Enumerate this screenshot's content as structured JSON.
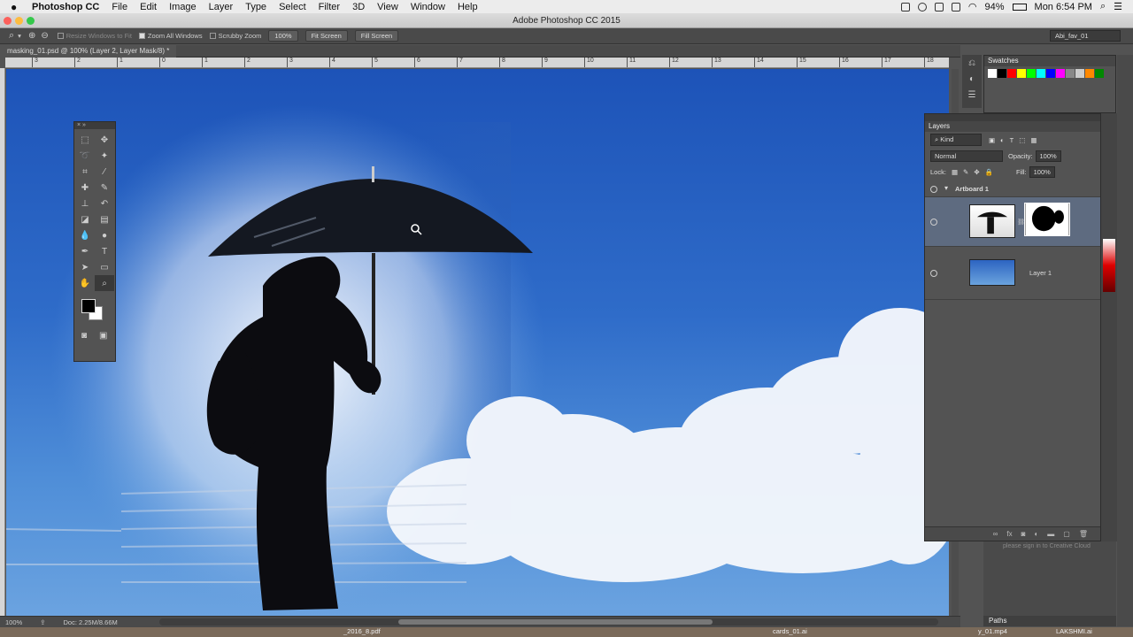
{
  "menubar": {
    "app_name": "Photoshop CC",
    "items": [
      "File",
      "Edit",
      "Image",
      "Layer",
      "Type",
      "Select",
      "Filter",
      "3D",
      "View",
      "Window",
      "Help"
    ],
    "battery": "94%",
    "clock": "Mon 6:54 PM"
  },
  "window": {
    "title": "Adobe Photoshop CC 2015"
  },
  "options": {
    "resize_windows": "Resize Windows to Fit",
    "zoom_all": "Zoom All Windows",
    "scrubby_zoom": "Scrubby Zoom",
    "zoom_percent": "100%",
    "fit_screen": "Fit Screen",
    "fill_screen": "Fill Screen",
    "workspace": "Abi_fav_01"
  },
  "document": {
    "tab_label": "masking_01.psd @ 100% (Layer 2, Layer Mask/8) *"
  },
  "ruler": {
    "ticks": [
      "3",
      "2",
      "1",
      "0",
      "1",
      "2",
      "3",
      "4",
      "5",
      "6",
      "7",
      "8",
      "9",
      "10",
      "11",
      "12",
      "13",
      "14",
      "15",
      "16",
      "17",
      "18"
    ]
  },
  "statusbar": {
    "zoom": "100%",
    "doc_size": "Doc: 2.25M/8.66M"
  },
  "dock": {
    "files": [
      "_2016_8.pdf",
      "cards_01.ai",
      "y_01.mp4",
      "LAKSHMI.ai"
    ]
  },
  "swatches": {
    "title": "Swatches",
    "colors": [
      "#ffffff",
      "#000000",
      "#ff0000",
      "#ffff00",
      "#00ff00",
      "#00ffff",
      "#0000ff",
      "#ff00ff",
      "#888888",
      "#cccccc",
      "#ff8800",
      "#008800"
    ]
  },
  "layers": {
    "title": "Layers",
    "filter_kind": "Kind",
    "blend_mode": "Normal",
    "opacity_label": "Opacity:",
    "opacity": "100%",
    "lock_label": "Lock:",
    "fill_label": "Fill:",
    "fill": "100%",
    "group_name": "Artboard 1",
    "layer1_name": "Layer 1"
  },
  "cc_signin": "please sign in to Creative Cloud",
  "paths_tab": "Paths"
}
